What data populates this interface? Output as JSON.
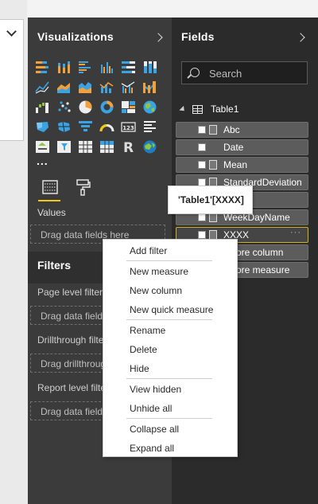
{
  "visualizations": {
    "title": "Visualizations",
    "icons": [
      "stacked-bar-icon",
      "stacked-column-icon",
      "clustered-bar-icon",
      "clustered-column-icon",
      "100-stacked-bar-icon",
      "100-stacked-column-icon",
      "line-chart-icon",
      "area-chart-icon",
      "stacked-area-icon",
      "line-column-icon",
      "line-clustered-column-icon",
      "ribbon-chart-icon",
      "waterfall-icon",
      "scatter-icon",
      "pie-chart-icon",
      "donut-chart-icon",
      "treemap-icon",
      "globe-map-icon",
      "filled-map-icon",
      "shape-map-icon",
      "funnel-icon",
      "gauge-icon",
      "card-icon",
      "multi-row-card-icon",
      "kpi-icon",
      "slicer-icon",
      "table-icon",
      "matrix-icon",
      "r-visual-icon",
      "arcgis-icon"
    ],
    "more": "...",
    "r_letter": "R",
    "card_text": "123",
    "values_label": "Values",
    "values_placeholder": "Drag data fields here"
  },
  "filters": {
    "title": "Filters",
    "page_level": "Page level filters",
    "page_level_drop": "Drag data fields here",
    "drillthrough": "Drillthrough filters",
    "drillthrough_drop": "Drag drillthrough fields here",
    "report_level": "Report level filters",
    "report_level_drop": "Drag data fields here"
  },
  "fields": {
    "title": "Fields",
    "search_placeholder": "Search",
    "table_name": "Table1",
    "items": [
      {
        "name": "Abc",
        "type": "measure"
      },
      {
        "name": "Date",
        "type": "none"
      },
      {
        "name": "Mean",
        "type": "calc"
      },
      {
        "name": "StandardDeviation",
        "type": "calc"
      },
      {
        "name": "",
        "type": "none"
      },
      {
        "name": "WeekDayName",
        "type": "calc"
      },
      {
        "name": "XXXX",
        "type": "measure",
        "selected": true,
        "more": "···"
      },
      {
        "name": "...core column",
        "type": "none"
      },
      {
        "name": "...core measure",
        "type": "none"
      }
    ]
  },
  "tooltip": "'Table1'[XXXX]",
  "context_menu": {
    "items": [
      "Add filter",
      "New measure",
      "New column",
      "New quick measure",
      "Rename",
      "Delete",
      "Hide",
      "View hidden",
      "Unhide all",
      "Collapse all",
      "Expand all"
    ]
  },
  "colors": {
    "accent": "#f2c811",
    "pane_dark": "#3b3b3b",
    "fields_dark": "#2b2b2b",
    "field_item": "#5c5c5c"
  }
}
